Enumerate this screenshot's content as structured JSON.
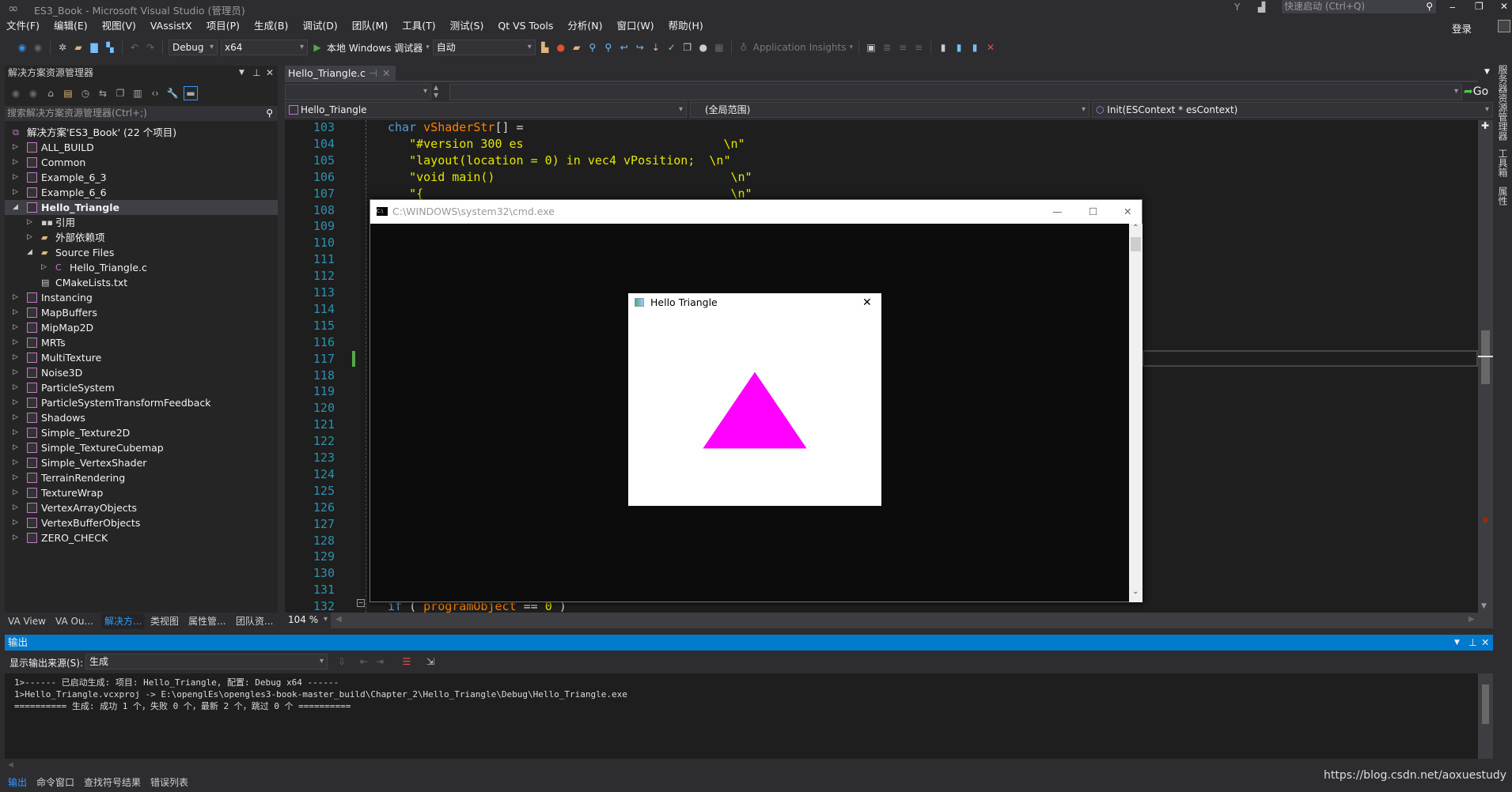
{
  "window": {
    "title": "ES3_Book - Microsoft Visual Studio (管理员)",
    "quick_launch_placeholder": "快速启动 (Ctrl+Q)",
    "sign_in": "登录"
  },
  "menu": [
    "文件(F)",
    "编辑(E)",
    "视图(V)",
    "VAssistX",
    "项目(P)",
    "生成(B)",
    "调试(D)",
    "团队(M)",
    "工具(T)",
    "测试(S)",
    "Qt VS Tools",
    "分析(N)",
    "窗口(W)",
    "帮助(H)"
  ],
  "toolbar": {
    "config": "Debug",
    "platform": "x64",
    "debugger": "本地 Windows 调试器",
    "debugger_mode": "自动",
    "app_insights": "Application Insights"
  },
  "solution_explorer": {
    "title": "解决方案资源管理器",
    "search_placeholder": "搜索解决方案资源管理器(Ctrl+;)",
    "items": [
      {
        "label": "解决方案'ES3_Book' (22 个项目)",
        "level": 0,
        "type": "solution"
      },
      {
        "label": "ALL_BUILD",
        "level": 1,
        "type": "project",
        "expander": "collapsed"
      },
      {
        "label": "Common",
        "level": 1,
        "type": "project",
        "expander": "collapsed"
      },
      {
        "label": "Example_6_3",
        "level": 1,
        "type": "project",
        "expander": "collapsed"
      },
      {
        "label": "Example_6_6",
        "level": 1,
        "type": "project",
        "expander": "collapsed"
      },
      {
        "label": "Hello_Triangle",
        "level": 1,
        "type": "project",
        "expander": "expanded",
        "selected": true
      },
      {
        "label": "引用",
        "level": 2,
        "type": "references",
        "expander": "collapsed"
      },
      {
        "label": "外部依赖项",
        "level": 2,
        "type": "folder",
        "expander": "collapsed"
      },
      {
        "label": "Source Files",
        "level": 2,
        "type": "folder",
        "expander": "expanded"
      },
      {
        "label": "Hello_Triangle.c",
        "level": 3,
        "type": "c-file",
        "expander": "collapsed"
      },
      {
        "label": "CMakeLists.txt",
        "level": 2,
        "type": "text-file"
      },
      {
        "label": "Instancing",
        "level": 1,
        "type": "project",
        "expander": "collapsed"
      },
      {
        "label": "MapBuffers",
        "level": 1,
        "type": "project",
        "expander": "collapsed"
      },
      {
        "label": "MipMap2D",
        "level": 1,
        "type": "project",
        "expander": "collapsed"
      },
      {
        "label": "MRTs",
        "level": 1,
        "type": "project",
        "expander": "collapsed"
      },
      {
        "label": "MultiTexture",
        "level": 1,
        "type": "project",
        "expander": "collapsed"
      },
      {
        "label": "Noise3D",
        "level": 1,
        "type": "project",
        "expander": "collapsed"
      },
      {
        "label": "ParticleSystem",
        "level": 1,
        "type": "project",
        "expander": "collapsed"
      },
      {
        "label": "ParticleSystemTransformFeedback",
        "level": 1,
        "type": "project",
        "expander": "collapsed"
      },
      {
        "label": "Shadows",
        "level": 1,
        "type": "project",
        "expander": "collapsed"
      },
      {
        "label": "Simple_Texture2D",
        "level": 1,
        "type": "project",
        "expander": "collapsed"
      },
      {
        "label": "Simple_TextureCubemap",
        "level": 1,
        "type": "project",
        "expander": "collapsed"
      },
      {
        "label": "Simple_VertexShader",
        "level": 1,
        "type": "project",
        "expander": "collapsed"
      },
      {
        "label": "TerrainRendering",
        "level": 1,
        "type": "project",
        "expander": "collapsed"
      },
      {
        "label": "TextureWrap",
        "level": 1,
        "type": "project",
        "expander": "collapsed"
      },
      {
        "label": "VertexArrayObjects",
        "level": 1,
        "type": "project",
        "expander": "collapsed"
      },
      {
        "label": "VertexBufferObjects",
        "level": 1,
        "type": "project",
        "expander": "collapsed"
      },
      {
        "label": "ZERO_CHECK",
        "level": 1,
        "type": "project",
        "expander": "collapsed"
      }
    ]
  },
  "left_tabs": [
    "VA View",
    "VA Ou...",
    "解决方...",
    "类视图",
    "属性管...",
    "团队资..."
  ],
  "left_tab_active": 2,
  "editor": {
    "tab": "Hello_Triangle.c",
    "nav_project": "Hello_Triangle",
    "nav_scope": "(全局范围)",
    "nav_function": "Init(ESContext * esContext)",
    "go": "Go",
    "zoom": "104 %",
    "line_numbers": [
      103,
      104,
      105,
      106,
      107,
      108,
      109,
      110,
      111,
      112,
      113,
      114,
      115,
      116,
      117,
      118,
      119,
      120,
      121,
      122,
      123,
      124,
      125,
      126,
      127,
      128,
      129,
      130,
      131,
      132
    ],
    "code": [
      {
        "line": 103,
        "parts": [
          [
            "kw",
            "char "
          ],
          [
            "id",
            "vShaderStr"
          ],
          [
            "",
            "[] ="
          ]
        ]
      },
      {
        "line": 104,
        "parts": [
          [
            "str",
            "   \"#version 300 es                            \\n\""
          ]
        ]
      },
      {
        "line": 105,
        "parts": [
          [
            "str",
            "   \"layout(location = 0) in vec4 vPosition;  \\n\""
          ]
        ]
      },
      {
        "line": 106,
        "parts": [
          [
            "str",
            "   \"void main()                                 \\n\""
          ]
        ]
      },
      {
        "line": 107,
        "parts": [
          [
            "str",
            "   \"{                                           \\n\""
          ]
        ]
      },
      {
        "line": 132,
        "parts": [
          [
            "kw",
            "if"
          ],
          [
            "",
            " ( "
          ],
          [
            "id",
            "programObject"
          ],
          [
            "",
            " == "
          ],
          [
            "str",
            "0"
          ],
          [
            "",
            " )"
          ]
        ]
      }
    ]
  },
  "console": {
    "title": "C:\\WINDOWS\\system32\\cmd.exe"
  },
  "gl_window": {
    "title": "Hello Triangle",
    "triangle_color": "#ff00ff",
    "vertices": [
      [
        0.0,
        0.5
      ],
      [
        -0.5,
        -0.5
      ],
      [
        0.5,
        -0.5
      ]
    ]
  },
  "output": {
    "title": "输出",
    "source_label": "显示输出来源(S):",
    "source_value": "生成",
    "lines": [
      "1>------ 已启动生成: 项目: Hello_Triangle, 配置: Debug x64 ------",
      "1>Hello_Triangle.vcxproj -> E:\\openglEs\\opengles3-book-master_build\\Chapter_2\\Hello_Triangle\\Debug\\Hello_Triangle.exe",
      "========== 生成: 成功 1 个，失败 0 个，最新 2 个，跳过 0 个 =========="
    ],
    "tabs": [
      "输出",
      "命令窗口",
      "查找符号结果",
      "错误列表"
    ]
  },
  "right_strip": [
    "服务器资源管理器",
    "工具箱",
    "属性"
  ],
  "watermark": "https://blog.csdn.net/aoxuestudy",
  "colors": {
    "accent": "#007acc",
    "background": "#2d2d30",
    "editor": "#1e1e1e"
  }
}
